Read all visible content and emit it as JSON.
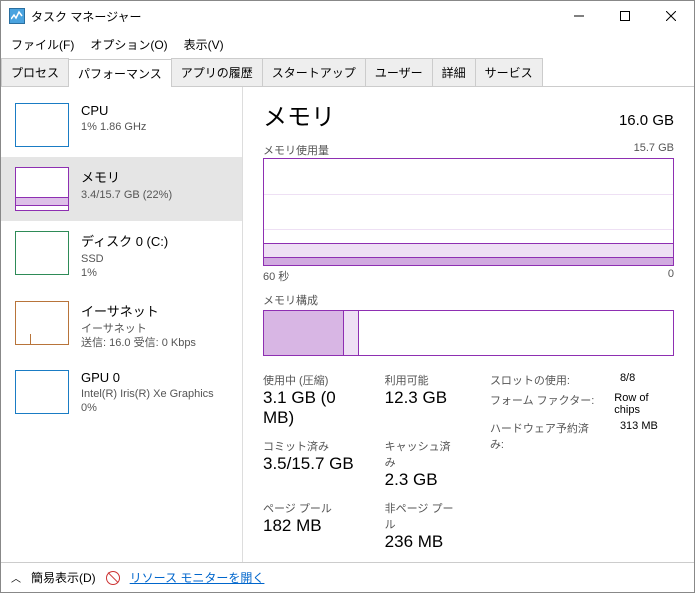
{
  "window": {
    "title": "タスク マネージャー"
  },
  "menu": {
    "file": "ファイル(F)",
    "options": "オプション(O)",
    "view": "表示(V)"
  },
  "tabs": [
    "プロセス",
    "パフォーマンス",
    "アプリの履歴",
    "スタートアップ",
    "ユーザー",
    "詳細",
    "サービス"
  ],
  "activeTab": 1,
  "sidebar": [
    {
      "name": "CPU",
      "sub": "1%   1.86 GHz"
    },
    {
      "name": "メモリ",
      "sub": "3.4/15.7 GB (22%)"
    },
    {
      "name": "ディスク 0 (C:)",
      "sub": "SSD\n1%"
    },
    {
      "name": "イーサネット",
      "sub": "イーサネット\n送信: 16.0 受信: 0 Kbps"
    },
    {
      "name": "GPU 0",
      "sub": "Intel(R) Iris(R) Xe Graphics\n0%"
    }
  ],
  "detail": {
    "title": "メモリ",
    "capacity": "16.0 GB",
    "usageLabel": "メモリ使用量",
    "usageMax": "15.7 GB",
    "axisLeft": "60 秒",
    "axisRight": "0",
    "compLabel": "メモリ構成",
    "stats": {
      "inUseLabel": "使用中 (圧縮)",
      "inUse": "3.1 GB (0 MB)",
      "availLabel": "利用可能",
      "avail": "12.3 GB",
      "commitLabel": "コミット済み",
      "commit": "3.5/15.7 GB",
      "cachedLabel": "キャッシュ済み",
      "cached": "2.3 GB",
      "pagedLabel": "ページ プール",
      "paged": "182 MB",
      "nonPagedLabel": "非ページ プール",
      "nonPaged": "236 MB"
    },
    "right": {
      "slotsLabel": "スロットの使用:",
      "slots": "8/8",
      "formLabel": "フォーム ファクター:",
      "form": "Row of chips",
      "hwLabel": "ハードウェア予約済み:",
      "hw": "313 MB"
    }
  },
  "footer": {
    "fewer": "簡易表示(D)",
    "resmon": "リソース モニターを開く"
  },
  "chart_data": {
    "type": "area",
    "title": "メモリ使用量",
    "xlabel": "秒",
    "ylabel": "GB",
    "x_range": [
      60,
      0
    ],
    "ylim": [
      0,
      15.7
    ],
    "series": [
      {
        "name": "使用中",
        "values": [
          3.4,
          3.4,
          3.4,
          3.4,
          3.4,
          3.4,
          3.4,
          3.4,
          3.4,
          3.4
        ]
      }
    ]
  }
}
